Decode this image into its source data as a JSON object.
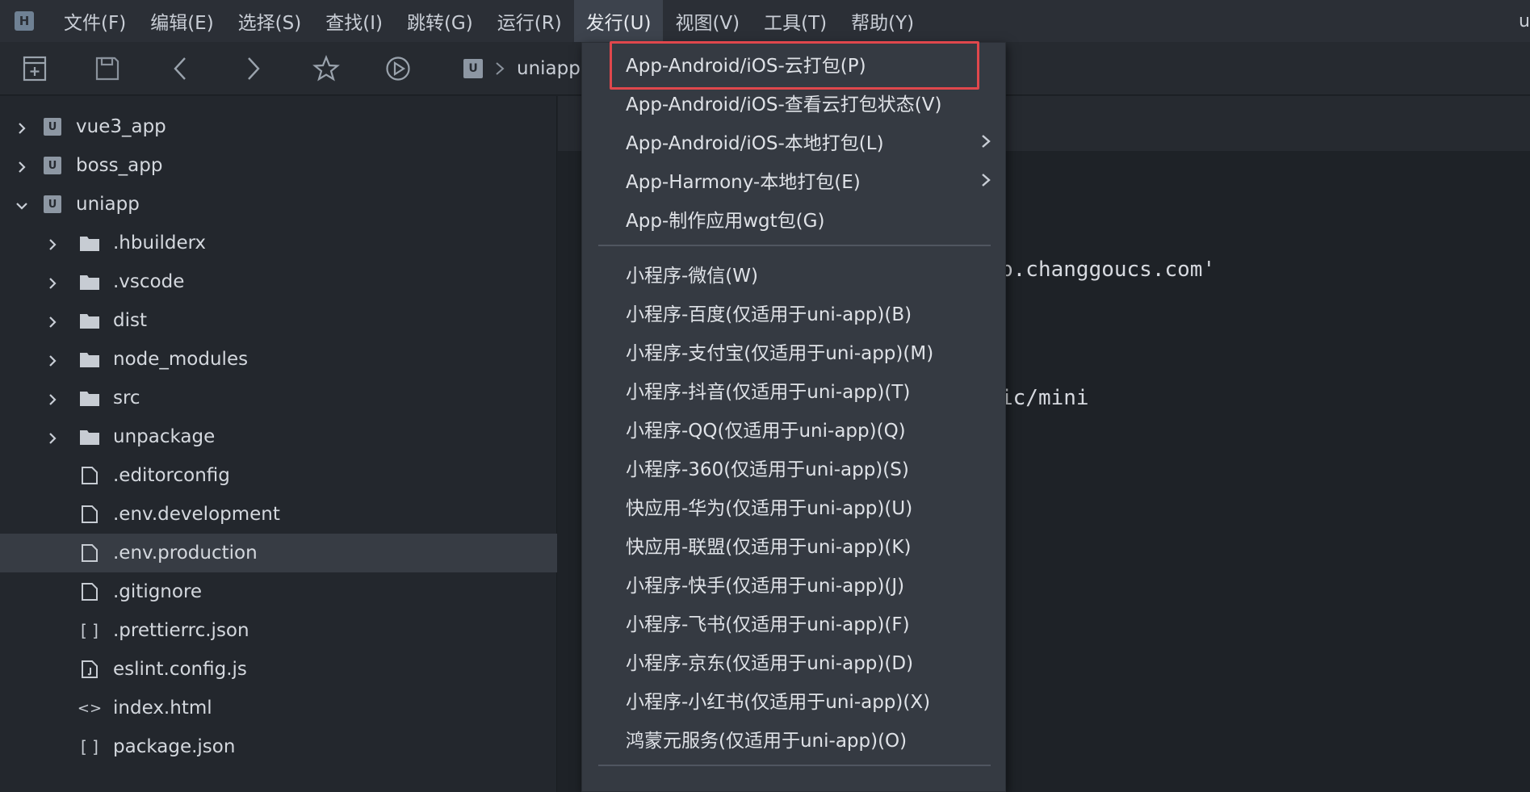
{
  "menubar": {
    "logo": "H",
    "items": [
      "文件(F)",
      "编辑(E)",
      "选择(S)",
      "查找(I)",
      "跳转(G)",
      "运行(R)",
      "发行(U)",
      "视图(V)",
      "工具(T)",
      "帮助(Y)"
    ],
    "active_index": 6,
    "edge_text": "u"
  },
  "toolbar": {
    "icons": [
      "new-file-icon",
      "save-icon",
      "back-icon",
      "forward-icon",
      "star-icon",
      "run-icon"
    ],
    "breadcrumb": {
      "project_logo": "U",
      "project": "uniapp"
    }
  },
  "sidebar": {
    "items": [
      {
        "label": "vue3_app",
        "level": 0,
        "type": "project",
        "expanded": false
      },
      {
        "label": "boss_app",
        "level": 0,
        "type": "project",
        "expanded": false
      },
      {
        "label": "uniapp",
        "level": 0,
        "type": "project",
        "expanded": true
      },
      {
        "label": ".hbuilderx",
        "level": 1,
        "type": "folder",
        "expanded": false
      },
      {
        "label": ".vscode",
        "level": 1,
        "type": "folder",
        "expanded": false
      },
      {
        "label": "dist",
        "level": 1,
        "type": "folder",
        "expanded": false
      },
      {
        "label": "node_modules",
        "level": 1,
        "type": "folder",
        "expanded": false
      },
      {
        "label": "src",
        "level": 1,
        "type": "folder",
        "expanded": false
      },
      {
        "label": "unpackage",
        "level": 1,
        "type": "folder",
        "expanded": false
      },
      {
        "label": ".editorconfig",
        "level": 1,
        "type": "file"
      },
      {
        "label": ".env.development",
        "level": 1,
        "type": "file"
      },
      {
        "label": ".env.production",
        "level": 1,
        "type": "file",
        "selected": true
      },
      {
        "label": ".gitignore",
        "level": 1,
        "type": "file"
      },
      {
        "label": ".prettierrc.json",
        "level": 1,
        "type": "json"
      },
      {
        "label": "eslint.config.js",
        "level": 1,
        "type": "js"
      },
      {
        "label": "index.html",
        "level": 1,
        "type": "html"
      },
      {
        "label": "package.json",
        "level": 1,
        "type": "json"
      }
    ],
    "json_glyph": "[ ]",
    "html_glyph": "<>",
    "project_logo": "U"
  },
  "editor": {
    "lines": [
      "p.changgoucs.com'",
      "ic/mini"
    ]
  },
  "dropdown": {
    "items": [
      {
        "label": "App-Android/iOS-云打包(P)",
        "highlighted": true
      },
      {
        "label": "App-Android/iOS-查看云打包状态(V)"
      },
      {
        "label": "App-Android/iOS-本地打包(L)",
        "submenu": true
      },
      {
        "label": "App-Harmony-本地打包(E)",
        "submenu": true
      },
      {
        "label": "App-制作应用wgt包(G)"
      },
      {
        "separator": true
      },
      {
        "label": "小程序-微信(W)"
      },
      {
        "label": "小程序-百度(仅适用于uni-app)(B)"
      },
      {
        "label": "小程序-支付宝(仅适用于uni-app)(M)"
      },
      {
        "label": "小程序-抖音(仅适用于uni-app)(T)"
      },
      {
        "label": "小程序-QQ(仅适用于uni-app)(Q)"
      },
      {
        "label": "小程序-360(仅适用于uni-app)(S)"
      },
      {
        "label": "快应用-华为(仅适用于uni-app)(U)"
      },
      {
        "label": "快应用-联盟(仅适用于uni-app)(K)"
      },
      {
        "label": "小程序-快手(仅适用于uni-app)(J)"
      },
      {
        "label": "小程序-飞书(仅适用于uni-app)(F)"
      },
      {
        "label": "小程序-京东(仅适用于uni-app)(D)"
      },
      {
        "label": "小程序-小红书(仅适用于uni-app)(X)"
      },
      {
        "label": "鸿蒙元服务(仅适用于uni-app)(O)"
      },
      {
        "separator": true
      }
    ]
  }
}
